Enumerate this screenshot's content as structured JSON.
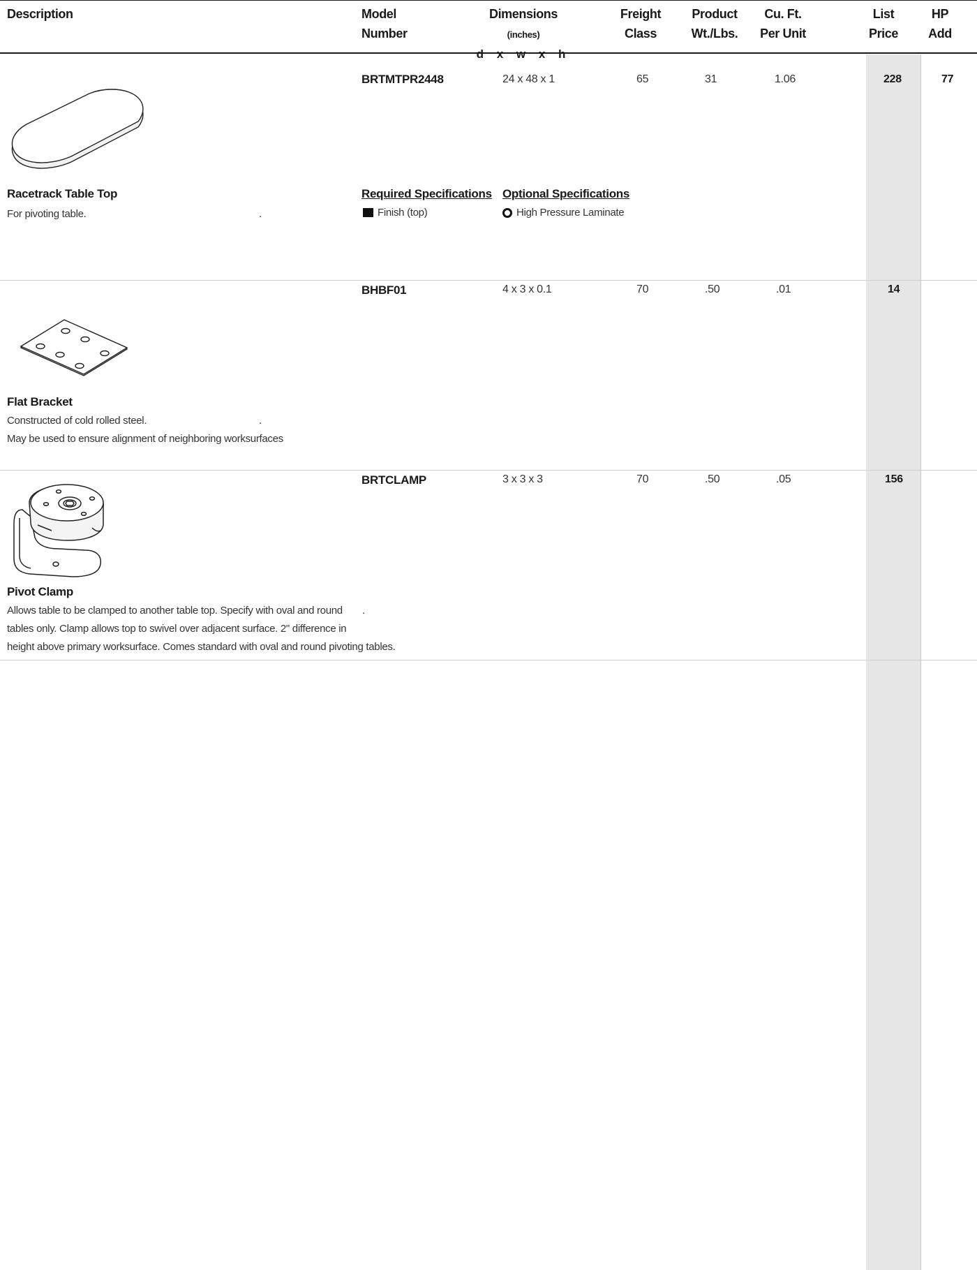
{
  "header": {
    "description": "Description",
    "model_l1": "Model",
    "model_l2": "Number",
    "dims_l1": "Dimensions",
    "dims_unit": "(inches)",
    "dims_l2": "d x w x h",
    "freight_l1": "Freight",
    "freight_l2": "Class",
    "product_l1": "Product",
    "product_l2": "Wt./Lbs.",
    "cuft_l1": "Cu. Ft.",
    "cuft_l2": "Per Unit",
    "list_l1": "List",
    "list_l2": "Price",
    "hp_l1": "HP",
    "hp_l2": "Add"
  },
  "products": [
    {
      "model": "BRTMTPR2448",
      "dims": "24 x 48 x 1",
      "freight": "65",
      "weight": "31",
      "cuft": "1.06",
      "price": "228",
      "hp_add": "77",
      "title": "Racetrack Table Top",
      "desc_lines": [
        "For pivoting table."
      ],
      "dot": ".",
      "required_heading": "Required Specifications",
      "required_item": "Finish (top)",
      "optional_heading": "Optional Specifications",
      "optional_item": "High Pressure Laminate",
      "icon": "racetrack-table-top-illustration"
    },
    {
      "model": "BHBF01",
      "dims": "4 x 3 x 0.1",
      "freight": "70",
      "weight": ".50",
      "cuft": ".01",
      "price": "14",
      "hp_add": "",
      "title": "Flat Bracket",
      "desc_lines": [
        "Constructed of cold rolled steel.",
        "May be used  to ensure alignment of neighboring worksurfaces"
      ],
      "dot": ".",
      "icon": "flat-bracket-illustration"
    },
    {
      "model": "BRTCLAMP",
      "dims": "3 x 3 x 3",
      "freight": "70",
      "weight": ".50",
      "cuft": ".05",
      "price": "156",
      "hp_add": "",
      "title": "Pivot Clamp",
      "desc_lines": [
        "Allows table to be clamped to another table top.  Specify with oval and round",
        "tables only.  Clamp allows top to swivel over adjacent surface.  2\" difference in",
        "height above primary worksurface.  Comes standard with oval and round pivoting tables."
      ],
      "dot": ".",
      "icon": "pivot-clamp-illustration"
    }
  ]
}
